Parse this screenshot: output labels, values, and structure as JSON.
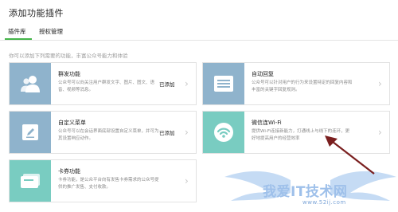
{
  "page": {
    "title": "添加功能插件"
  },
  "tabs": [
    {
      "label": "插件库",
      "active": true
    },
    {
      "label": "授权管理",
      "active": false
    }
  ],
  "hint": "你可以添加下列需要的功能，丰富公众号能力和体验",
  "plugins": [
    {
      "title": "群发功能",
      "desc": "公众号可以向关注用户群发文字、图片、图文、语音、视频等消息。",
      "status": "已添加",
      "icon": "users-icon",
      "color": "#8fb3cc"
    },
    {
      "title": "自动回复",
      "desc": "公众号可以针对用户的行为来设置特定的回复内容和丰富的关键字回复规则。",
      "status": "",
      "icon": "message-list-icon",
      "color": "#8fb3cc"
    },
    {
      "title": "自定义菜单",
      "desc": "公众号可以在会话界面底部设置自定义菜单，并可为其设置响应动作。",
      "status": "已添加",
      "icon": "edit-icon",
      "color": "#8fb3cc"
    },
    {
      "title": "微信连Wi-Fi",
      "desc": "提供Wi-Fi连接新能力，打通线上与线下的连环，更好地提高用户的经营效率",
      "status": "",
      "icon": "wifi-icon",
      "color": "#79ccc1"
    },
    {
      "title": "卡券功能",
      "desc": "卡券功能，是公众平台向有发售卡券需求的公众号提供的推广发售、支付收款。",
      "status": "",
      "icon": "card-icon",
      "color": "#79ccc1"
    }
  ],
  "watermark": {
    "text": "我爱IT技术网",
    "url": "www.52ij.com"
  },
  "colors": {
    "accent": "#44b549",
    "thumb_blue": "#8fb3cc",
    "thumb_teal": "#79ccc1",
    "annotation_arrow": "#7a1f1f"
  }
}
